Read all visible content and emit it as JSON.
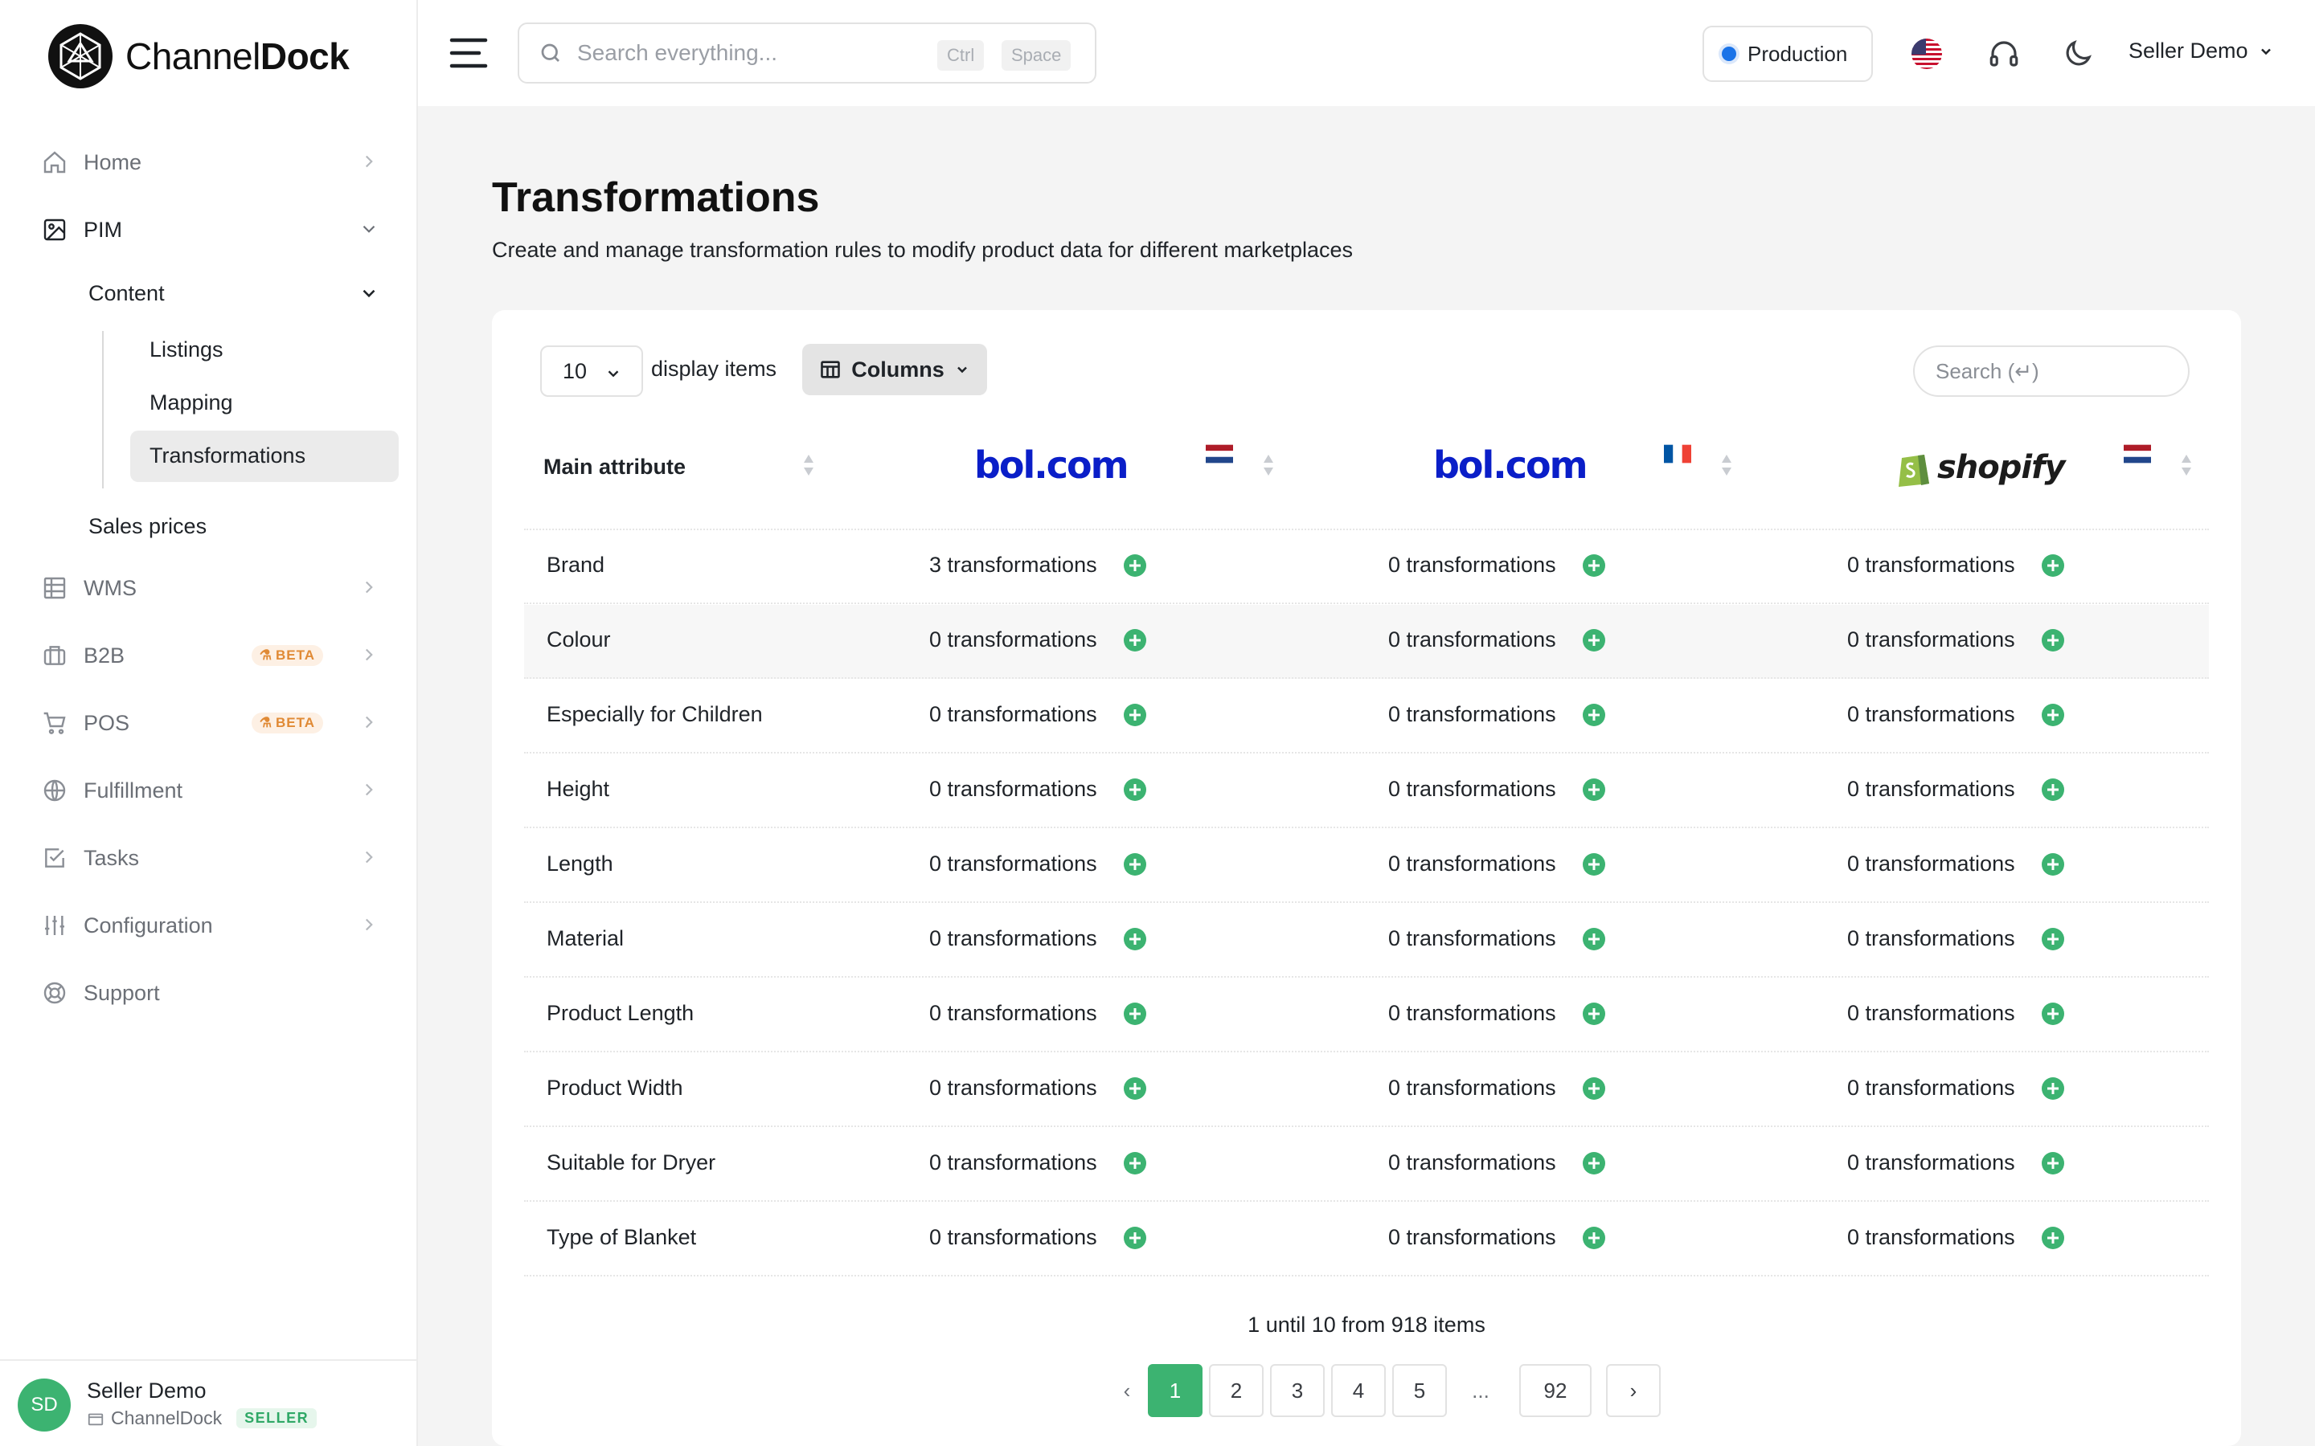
{
  "app": {
    "logo_text_light": "Channel",
    "logo_text_bold": "Dock"
  },
  "sidebar": {
    "items": [
      {
        "label": "Home",
        "icon": "home-icon"
      },
      {
        "label": "PIM",
        "icon": "image-icon"
      },
      {
        "label": "WMS",
        "icon": "grid-icon"
      },
      {
        "label": "B2B",
        "icon": "briefcase-icon",
        "badge": "BETA"
      },
      {
        "label": "POS",
        "icon": "cart-icon",
        "badge": "BETA"
      },
      {
        "label": "Fulfillment",
        "icon": "globe-icon"
      },
      {
        "label": "Tasks",
        "icon": "checkbox-icon"
      },
      {
        "label": "Configuration",
        "icon": "sliders-icon"
      },
      {
        "label": "Support",
        "icon": "lifebuoy-icon"
      }
    ],
    "pim_sub": {
      "content": "Content",
      "children": [
        "Listings",
        "Mapping",
        "Transformations"
      ],
      "sales_prices": "Sales prices"
    },
    "user": {
      "initials": "SD",
      "name": "Seller Demo",
      "company": "ChannelDock",
      "role": "SELLER"
    }
  },
  "topbar": {
    "search_placeholder": "Search everything...",
    "kbd1": "Ctrl",
    "kbd2": "Space",
    "environment": "Production",
    "user_menu": "Seller Demo"
  },
  "page": {
    "title": "Transformations",
    "subtitle": "Create and manage transformation rules to modify product data for different marketplaces"
  },
  "table": {
    "page_size": "10",
    "display_items": "display items",
    "columns_label": "Columns",
    "search_placeholder": "Search (↵)",
    "header_main": "Main attribute",
    "channels": [
      {
        "brand": "bol.com",
        "flag": "NL"
      },
      {
        "brand": "bol.com",
        "flag": "FR"
      },
      {
        "brand": "shopify",
        "flag": "NL"
      }
    ],
    "rows": [
      {
        "attr": "Brand",
        "counts": [
          "3 transformations",
          "0 transformations",
          "0 transformations"
        ]
      },
      {
        "attr": "Colour",
        "counts": [
          "0 transformations",
          "0 transformations",
          "0 transformations"
        ]
      },
      {
        "attr": "Especially for Children",
        "counts": [
          "0 transformations",
          "0 transformations",
          "0 transformations"
        ]
      },
      {
        "attr": "Height",
        "counts": [
          "0 transformations",
          "0 transformations",
          "0 transformations"
        ]
      },
      {
        "attr": "Length",
        "counts": [
          "0 transformations",
          "0 transformations",
          "0 transformations"
        ]
      },
      {
        "attr": "Material",
        "counts": [
          "0 transformations",
          "0 transformations",
          "0 transformations"
        ]
      },
      {
        "attr": "Product Length",
        "counts": [
          "0 transformations",
          "0 transformations",
          "0 transformations"
        ]
      },
      {
        "attr": "Product Width",
        "counts": [
          "0 transformations",
          "0 transformations",
          "0 transformations"
        ]
      },
      {
        "attr": "Suitable for Dryer",
        "counts": [
          "0 transformations",
          "0 transformations",
          "0 transformations"
        ]
      },
      {
        "attr": "Type of Blanket",
        "counts": [
          "0 transformations",
          "0 transformations",
          "0 transformations"
        ]
      }
    ],
    "summary": "1 until 10 from 918 items",
    "pages": [
      "1",
      "2",
      "3",
      "4",
      "5",
      "...",
      "92"
    ],
    "prev": "‹",
    "next": "›"
  },
  "colors": {
    "accent_green": "#3cb371",
    "bol_blue": "#0a1ec8",
    "env_dot": "#1a73e8",
    "beta_orange": "#e08a35"
  }
}
